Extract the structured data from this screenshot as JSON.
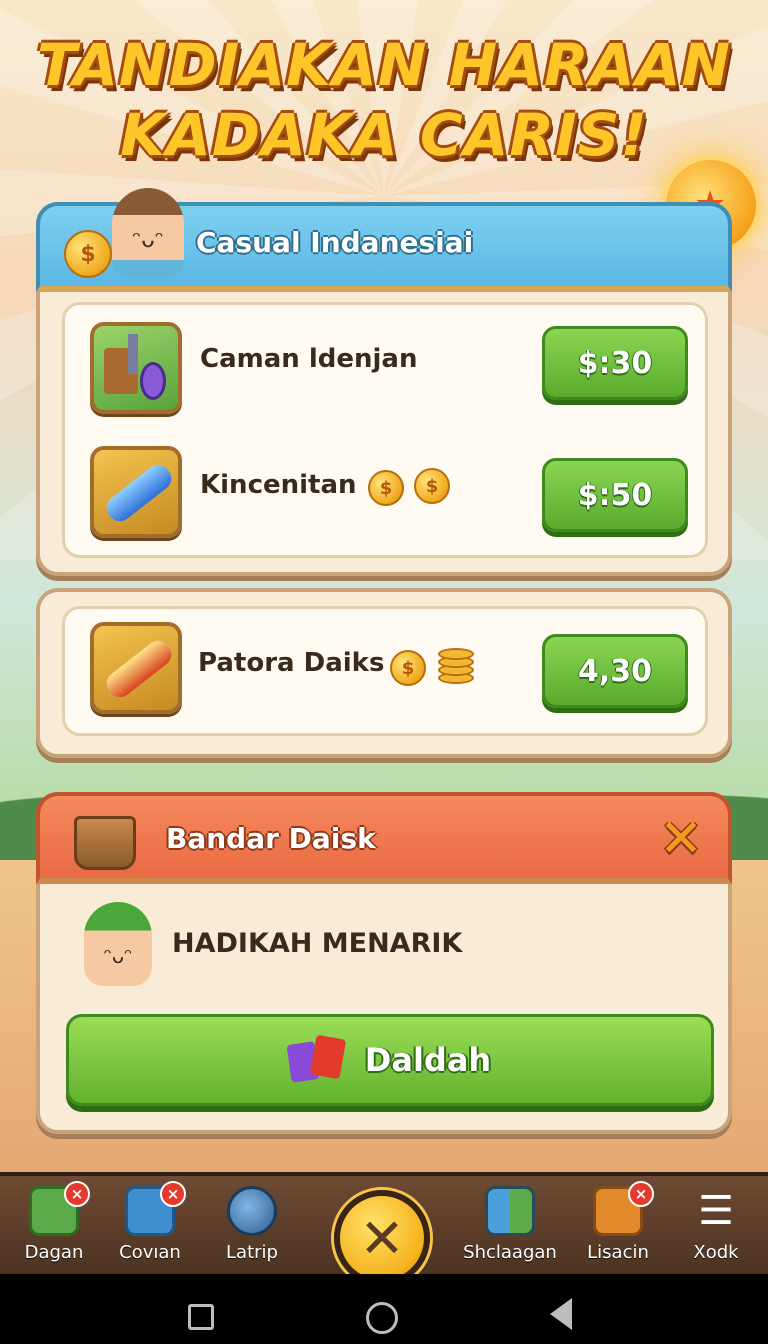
{
  "title": {
    "line1": "TANDIAKAN HARAAN",
    "line2": "KADAKA CARIS!"
  },
  "shop_panel": {
    "header": "Casual Indanesiai",
    "items": [
      {
        "name": "Caman ldenjan",
        "price": "$:30"
      },
      {
        "name": "Kincenitan",
        "price": "$:50"
      },
      {
        "name": "Patora Daiks",
        "price": "4,30"
      }
    ]
  },
  "reward_panel": {
    "header": "Bandar Daisk",
    "message": "HADIKAH MENARIK",
    "button_label": "Daldah"
  },
  "nav": {
    "items": [
      {
        "label": "Dagan",
        "icon": "dice-box-icon",
        "badge": "×"
      },
      {
        "label": "Covıan",
        "icon": "puzzle-icon",
        "badge": "×"
      },
      {
        "label": "Latrip",
        "icon": "globe-icon"
      },
      {
        "label": "Shclaagan",
        "icon": "gift-boxes-icon"
      },
      {
        "label": "Lisacin",
        "icon": "gift-icon",
        "badge": "×"
      },
      {
        "label": "Xodk",
        "icon": "menu-icon"
      }
    ],
    "center_icon": "close-icon"
  },
  "colors": {
    "accent_green": "#61b22d",
    "header_blue": "#5ab7e5",
    "header_red": "#e96a44",
    "title_gold": "#ffc62a"
  }
}
